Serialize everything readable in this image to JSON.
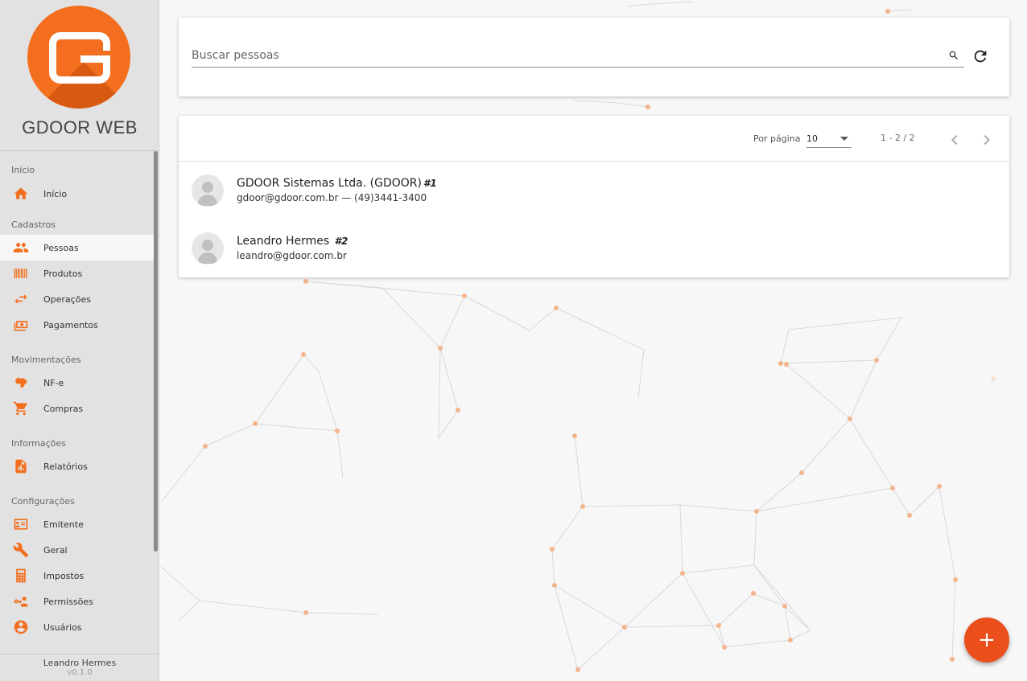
{
  "app": {
    "name": "GDOOR WEB"
  },
  "sidebar": {
    "sections": [
      {
        "title": "Início",
        "items": [
          {
            "label": "Início",
            "icon": "home-icon"
          }
        ]
      },
      {
        "title": "Cadastros",
        "items": [
          {
            "label": "Pessoas",
            "icon": "people-icon",
            "active": true
          },
          {
            "label": "Produtos",
            "icon": "barcode-icon"
          },
          {
            "label": "Operações",
            "icon": "swap-icon"
          },
          {
            "label": "Pagamentos",
            "icon": "money-icon"
          }
        ]
      },
      {
        "title": "Movimentações",
        "items": [
          {
            "label": "NF-e",
            "icon": "brazil-map-icon"
          },
          {
            "label": "Compras",
            "icon": "cart-icon"
          }
        ]
      },
      {
        "title": "Informações",
        "items": [
          {
            "label": "Relatórios",
            "icon": "report-icon"
          }
        ]
      },
      {
        "title": "Configurações",
        "items": [
          {
            "label": "Emitente",
            "icon": "id-card-icon"
          },
          {
            "label": "Geral",
            "icon": "wrench-icon"
          },
          {
            "label": "Impostos",
            "icon": "calculator-icon"
          },
          {
            "label": "Permissões",
            "icon": "key-person-icon"
          },
          {
            "label": "Usuários",
            "icon": "account-icon"
          }
        ]
      }
    ],
    "footer": {
      "user": "Leandro Hermes",
      "version": "v0.1.0"
    }
  },
  "search": {
    "placeholder": "Buscar pessoas",
    "value": ""
  },
  "pagination": {
    "per_page_label": "Por página",
    "per_page_value": "10",
    "range": "1 - 2 / 2"
  },
  "people": [
    {
      "name": "GDOOR Sistemas Ltda. (GDOOR)",
      "code": "#1",
      "info": "gdoor@gdoor.com.br — (49)3441-3400"
    },
    {
      "name": "Leandro Hermes",
      "code": "#2",
      "info": "leandro@gdoor.com.br"
    }
  ],
  "fab": {
    "label": "+"
  },
  "colors": {
    "accent": "#f36f1f",
    "fab": "#ea4f1c",
    "sidebar_bg": "#e2e2e2"
  }
}
